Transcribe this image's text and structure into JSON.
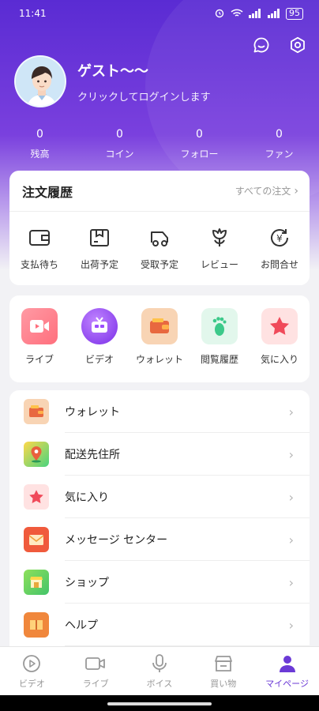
{
  "status": {
    "time": "11:41",
    "battery": "95"
  },
  "profile": {
    "name": "ゲスト〜〜",
    "subtitle": "クリックしてログインします"
  },
  "stats": [
    {
      "value": "0",
      "label": "残高"
    },
    {
      "value": "0",
      "label": "コイン"
    },
    {
      "value": "0",
      "label": "フォロー"
    },
    {
      "value": "0",
      "label": "ファン"
    }
  ],
  "orders": {
    "title": "注文履歴",
    "all_label": "すべての注文",
    "items": [
      {
        "label": "支払待ち",
        "icon": "wallet-icon"
      },
      {
        "label": "出荷予定",
        "icon": "package-icon"
      },
      {
        "label": "受取予定",
        "icon": "truck-icon"
      },
      {
        "label": "レビュー",
        "icon": "flower-icon"
      },
      {
        "label": "お問合せ",
        "icon": "yen-refund-icon"
      }
    ]
  },
  "quick": [
    {
      "label": "ライブ",
      "icon": "video-camera-icon",
      "color": "#ff6f7d"
    },
    {
      "label": "ビデオ",
      "icon": "tv-icon",
      "color": "#9b4dff"
    },
    {
      "label": "ウォレット",
      "icon": "wallet-icon",
      "color": "#f6c9a2"
    },
    {
      "label": "閲覧履歴",
      "icon": "footprint-icon",
      "color": "#e4f8ee"
    },
    {
      "label": "気に入り",
      "icon": "star-icon",
      "color": "#ffe2e2"
    }
  ],
  "menu": [
    {
      "label": "ウォレット",
      "icon": "wallet-icon"
    },
    {
      "label": "配送先住所",
      "icon": "map-pin-icon"
    },
    {
      "label": "気に入り",
      "icon": "star-icon"
    },
    {
      "label": "メッセージ センター",
      "icon": "envelope-icon"
    },
    {
      "label": "ショップ",
      "icon": "shop-icon"
    },
    {
      "label": "ヘルプ",
      "icon": "help-book-icon"
    }
  ],
  "tabs": [
    {
      "label": "ビデオ",
      "icon": "play-circle-icon",
      "active": false
    },
    {
      "label": "ライブ",
      "icon": "video-camera-icon",
      "active": false
    },
    {
      "label": "ボイス",
      "icon": "microphone-icon",
      "active": false
    },
    {
      "label": "買い物",
      "icon": "store-icon",
      "active": false
    },
    {
      "label": "マイページ",
      "icon": "user-icon",
      "active": true
    }
  ],
  "colors": {
    "accent": "#6b3ad6",
    "hero_top": "#5a2bd3",
    "background": "#f2f2f5"
  }
}
